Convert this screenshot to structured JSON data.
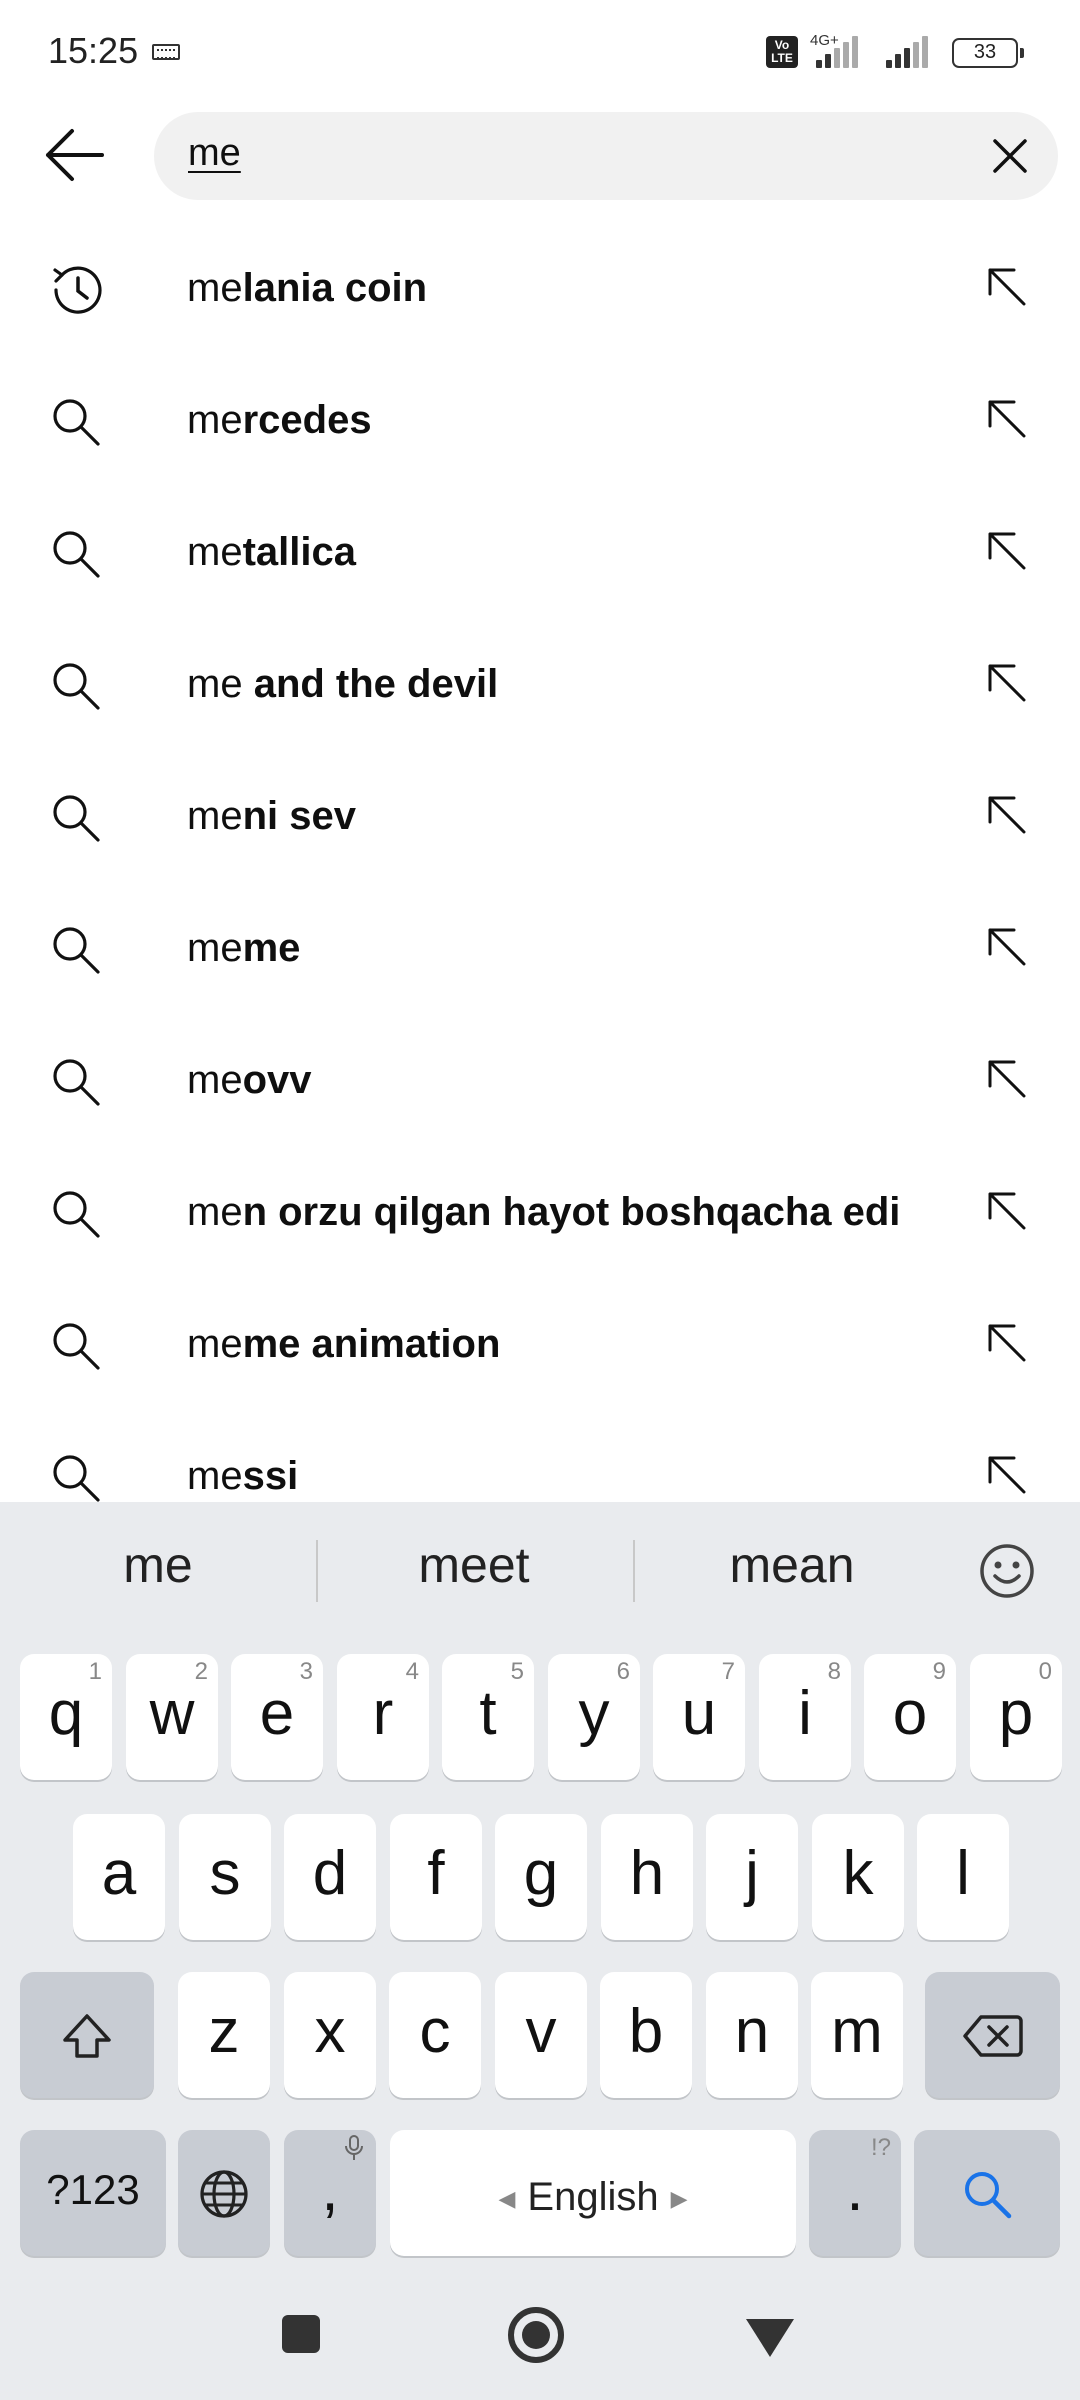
{
  "status_bar": {
    "time": "15:25",
    "volte": "Vo LTE",
    "network": "4G+",
    "battery": "33"
  },
  "search": {
    "query": "me"
  },
  "suggestions": [
    {
      "prefix": "me",
      "rest": "lania coin",
      "icon": "history-icon"
    },
    {
      "prefix": "me",
      "rest": "rcedes",
      "icon": "search-icon"
    },
    {
      "prefix": "me",
      "rest": "tallica",
      "icon": "search-icon"
    },
    {
      "prefix": "me",
      "rest": " and the devil",
      "icon": "search-icon"
    },
    {
      "prefix": "me",
      "rest": "ni sev",
      "icon": "search-icon"
    },
    {
      "prefix": "me",
      "rest": "me",
      "icon": "search-icon"
    },
    {
      "prefix": "me",
      "rest": "ovv",
      "icon": "search-icon"
    },
    {
      "prefix": "me",
      "rest": "n orzu qilgan hayot boshqacha edi",
      "icon": "search-icon"
    },
    {
      "prefix": "me",
      "rest": "me animation",
      "icon": "search-icon"
    },
    {
      "prefix": "me",
      "rest": "ssi",
      "icon": "search-icon"
    }
  ],
  "keyboard": {
    "predictions": [
      "me",
      "meet",
      "mean"
    ],
    "row1": [
      {
        "key": "q",
        "hint": "1"
      },
      {
        "key": "w",
        "hint": "2"
      },
      {
        "key": "e",
        "hint": "3"
      },
      {
        "key": "r",
        "hint": "4"
      },
      {
        "key": "t",
        "hint": "5"
      },
      {
        "key": "y",
        "hint": "6"
      },
      {
        "key": "u",
        "hint": "7"
      },
      {
        "key": "i",
        "hint": "8"
      },
      {
        "key": "o",
        "hint": "9"
      },
      {
        "key": "p",
        "hint": "0"
      }
    ],
    "row2": [
      "a",
      "s",
      "d",
      "f",
      "g",
      "h",
      "j",
      "k",
      "l"
    ],
    "row3": [
      "z",
      "x",
      "c",
      "v",
      "b",
      "n",
      "m"
    ],
    "symbols_key": "?123",
    "comma_key": ",",
    "period_key": ".",
    "period_hint": "!?",
    "space_label": "English"
  },
  "colors": {
    "search_accent": "#1a73e8",
    "keyboard_bg": "#e9ebee",
    "func_key": "#c8ccd3"
  }
}
